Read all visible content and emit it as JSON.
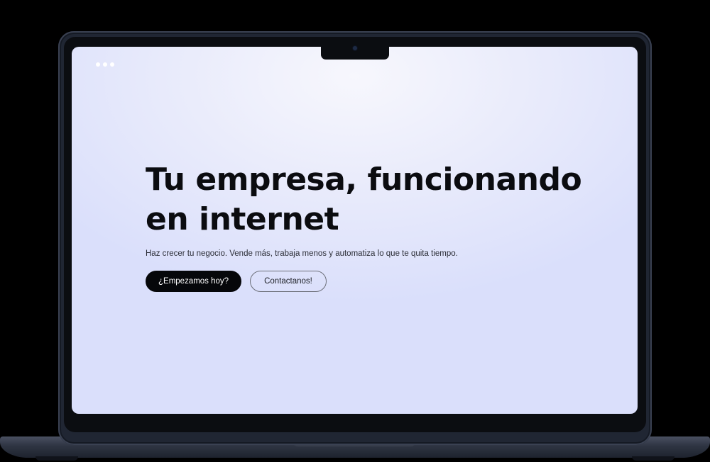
{
  "window": {
    "controls": [
      "dot",
      "dot",
      "dot"
    ]
  },
  "hero": {
    "headline_line1": "Tu empresa, funcionando",
    "headline_line2": "en internet",
    "subtext": "Haz crecer tu negocio. Vende más, trabaja menos y automatiza lo que te quita tiempo.",
    "primary_button": "¿Empezamos hoy?",
    "secondary_button": "Contactanos!"
  },
  "colors": {
    "page_background": "#000000",
    "screen_background": "#e6e9fb",
    "primary_button_bg": "#06070a",
    "headline_text": "#0b0c10",
    "device_frame": "#202633"
  }
}
